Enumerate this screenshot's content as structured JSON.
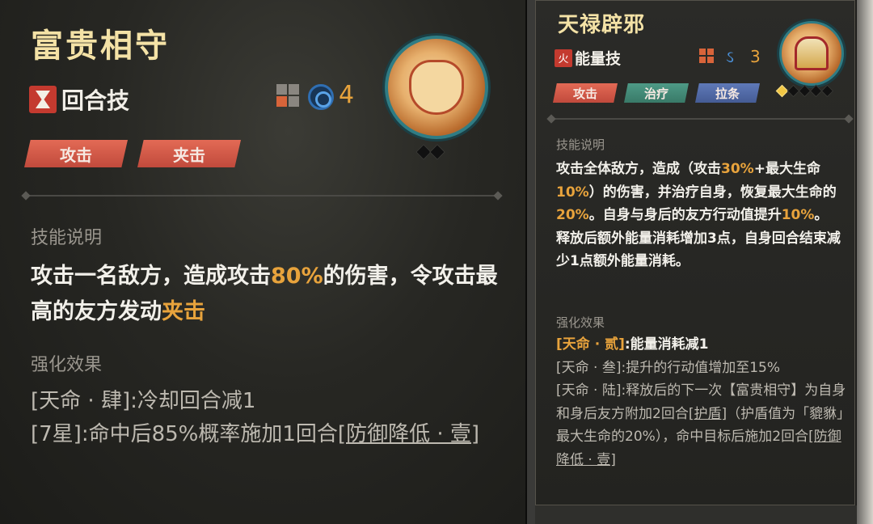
{
  "left_card": {
    "title": "富贵相守",
    "type_label": "回合技",
    "cost": "4",
    "tags": [
      "攻击",
      "夹击"
    ],
    "section_desc": "技能说明",
    "desc_part1": "攻击一名敌方，造成攻击",
    "desc_hl1": "80%",
    "desc_part2": "的伤害，令攻击最高的友方发动",
    "desc_hl2": "夹击",
    "section_effect": "强化效果",
    "effect1": "[天命 · 肆]:冷却回合减1",
    "effect2_pre": "[7星]:命中后85%概率施加1回合",
    "effect2_link": "[防御降低 · 壹]",
    "stars_filled": 0,
    "stars_total": 2
  },
  "right_card": {
    "title": "天禄辟邪",
    "type_icon": "火",
    "type_label": "能量技",
    "cost": "3",
    "swirl_icon": "ઽ",
    "tags": [
      "攻击",
      "治疗",
      "拉条"
    ],
    "section_desc": "技能说明",
    "desc1_a": "攻击全体敌方，造成（攻击",
    "desc1_hl1": "30%",
    "desc1_b": "+最大生命",
    "desc1_hl2": "10%",
    "desc1_c": "）的伤害，并治疗自身，恢复最大生命的",
    "desc1_hl3": "20%",
    "desc1_d": "。自身与身后的友方行动值提升",
    "desc1_hl4": "10%",
    "desc1_e": "。",
    "desc2": "释放后额外能量消耗增加3点，自身回合结束减少1点额外能量消耗。",
    "section_effect": "强化效果",
    "effect1_tag": "[天命 · 贰]",
    "effect1_text": ":能量消耗减1",
    "effect2": "[天命 · 叁]:提升的行动值增加至15%",
    "effect3_a": "[天命 · 陆]:释放后的下一次【富贵相守】为自身和身后友方附加2回合",
    "effect3_link1": "[护盾]",
    "effect3_b": "（护盾值为「貔貅」最大生命的20%），命中目标后施加2回合",
    "effect3_link2": "[防御降低 · 壹]",
    "stars_filled": 1,
    "stars_total": 5
  },
  "colors": {
    "title": "#f4e2a6",
    "highlight": "#e8a33c",
    "tag_red": "#d35a47",
    "tag_teal": "#4a8f7c",
    "tag_blue": "#566fae"
  }
}
